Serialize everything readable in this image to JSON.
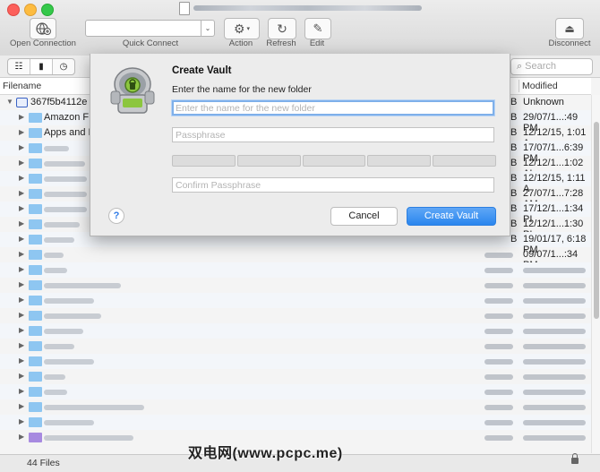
{
  "toolbar": {
    "open_connection": "Open Connection",
    "quick_connect": "Quick Connect",
    "action": "Action",
    "refresh": "Refresh",
    "edit": "Edit",
    "disconnect": "Disconnect"
  },
  "search": {
    "placeholder": "Search"
  },
  "columns": {
    "filename": "Filename",
    "modified": "Modified"
  },
  "rows": [
    {
      "name": "367f5b4112e",
      "size": "B",
      "modified": "Unknown"
    },
    {
      "name": "Amazon FB",
      "size": "B",
      "modified": "29/07/1...:49 PM"
    },
    {
      "name": "Apps and I",
      "size": "B",
      "modified": "12/12/15, 1:01 A"
    },
    {
      "name": "",
      "size": "B",
      "modified": "17/07/1...6:39 PM"
    },
    {
      "name": "",
      "size": "B",
      "modified": "12/12/1...1:02 AI"
    },
    {
      "name": "",
      "size": "B",
      "modified": "12/12/15, 1:11 A"
    },
    {
      "name": "",
      "size": "B",
      "modified": "27/07/1...7:28 AM"
    },
    {
      "name": "",
      "size": "B",
      "modified": "17/12/1...1:34 PI"
    },
    {
      "name": "",
      "size": "B",
      "modified": "12/12/1...1:30 PI"
    },
    {
      "name": "",
      "size": "B",
      "modified": "19/01/17, 6:18 PM"
    },
    {
      "name": "",
      "size": "",
      "modified": "09/07/1...:34 PM"
    }
  ],
  "dialog": {
    "title": "Create Vault",
    "prompt": "Enter the name for the new folder",
    "name_placeholder": "Enter the name for the new folder",
    "passphrase_placeholder": "Passphrase",
    "confirm_placeholder": "Confirm Passphrase",
    "help": "?",
    "cancel": "Cancel",
    "create": "Create Vault"
  },
  "status": {
    "file_count": "44 Files"
  },
  "watermark": "双电网(www.pcpc.me)"
}
